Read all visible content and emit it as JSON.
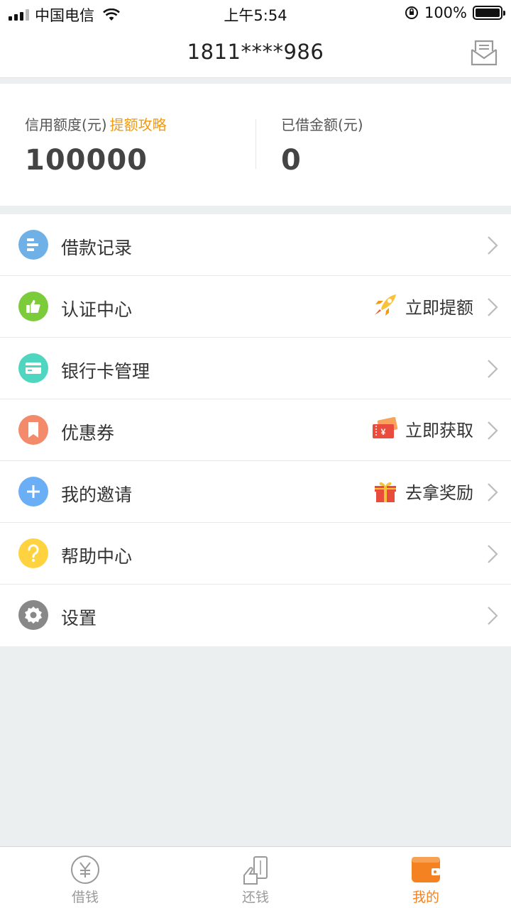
{
  "status_bar": {
    "carrier": "中国电信",
    "time": "上午5:54",
    "battery": "100%"
  },
  "header": {
    "title": "1811****986",
    "icons": [
      "mail-icon"
    ]
  },
  "summary": {
    "credit_label": "信用额度(元)",
    "credit_link": "提额攻略",
    "credit_value": "100000",
    "borrowed_label": "已借金额(元)",
    "borrowed_value": "0"
  },
  "menu": {
    "items": [
      {
        "label": "借款记录",
        "icon": "record-icon",
        "color": "#6fb1e6"
      },
      {
        "label": "认证中心",
        "icon": "thumbs-up-icon",
        "color": "#7ccb3a",
        "action": "立即提额",
        "action_icon": "rocket-icon"
      },
      {
        "label": "银行卡管理",
        "icon": "bank-card-icon",
        "color": "#4fd6c0"
      },
      {
        "label": "优惠券",
        "icon": "coupon-icon",
        "color": "#f28a6b",
        "action": "立即获取",
        "action_icon": "ticket-icon"
      },
      {
        "label": "我的邀请",
        "icon": "plus-icon",
        "color": "#6aaef5",
        "action": "去拿奖励",
        "action_icon": "gift-icon"
      },
      {
        "label": "帮助中心",
        "icon": "help-icon",
        "color": "#ffd23f"
      },
      {
        "label": "设置",
        "icon": "gear-icon",
        "color": "#888888"
      }
    ]
  },
  "tabs": [
    {
      "label": "借钱",
      "icon": "yuan-icon",
      "active": false
    },
    {
      "label": "还钱",
      "icon": "repay-icon",
      "active": false
    },
    {
      "label": "我的",
      "icon": "wallet-icon",
      "active": true
    }
  ],
  "colors": {
    "accent": "#f58220",
    "link": "#f29b12",
    "background": "#eceff0"
  }
}
